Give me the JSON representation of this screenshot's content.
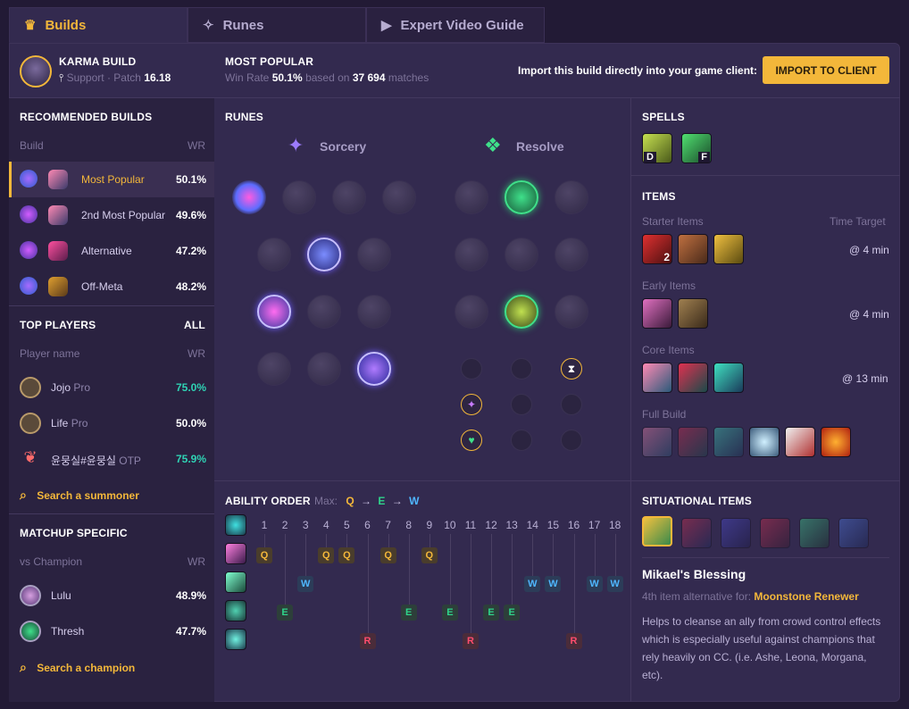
{
  "tabs": [
    {
      "label": "Builds",
      "icon": "builds-icon"
    },
    {
      "label": "Runes",
      "icon": "runes-icon"
    },
    {
      "label": "Expert Video Guide",
      "icon": "video-icon"
    }
  ],
  "header": {
    "champ_title": "KARMA BUILD",
    "role": "Support",
    "patch_prefix": "· Patch",
    "patch": "16.18",
    "mp_title": "MOST POPULAR",
    "winrate_label": "Win Rate",
    "winrate": "50.1%",
    "based_on": "based on",
    "matches": "37 694",
    "matches_suffix": "matches",
    "import_text": "Import this build directly into your game client:",
    "import_button": "IMPORT TO CLIENT"
  },
  "recommended": {
    "title": "RECOMMENDED BUILDS",
    "col_build": "Build",
    "col_wr": "WR",
    "rows": [
      {
        "name": "Most Popular",
        "wr": "50.1%",
        "active": true
      },
      {
        "name": "2nd Most Popular",
        "wr": "49.6%"
      },
      {
        "name": "Alternative",
        "wr": "47.2%"
      },
      {
        "name": "Off-Meta",
        "wr": "48.2%"
      }
    ]
  },
  "top_players": {
    "title": "TOP PLAYERS",
    "all": "ALL",
    "col_player": "Player name",
    "col_wr": "WR",
    "rows": [
      {
        "name": "Jojo",
        "tag": "Pro",
        "wr": "75.0%"
      },
      {
        "name": "Life",
        "tag": "Pro",
        "wr": "50.0%"
      },
      {
        "name": "윤뭉실#윤뭉실",
        "tag": "OTP",
        "wr": "75.9%"
      }
    ],
    "search": "Search a summoner"
  },
  "matchup": {
    "title": "MATCHUP SPECIFIC",
    "col_vs": "vs Champion",
    "col_wr": "WR",
    "rows": [
      {
        "name": "Lulu",
        "wr": "48.9%"
      },
      {
        "name": "Thresh",
        "wr": "47.7%"
      }
    ],
    "search": "Search a champion"
  },
  "runes": {
    "title": "RUNES",
    "primary": "Sorcery",
    "secondary": "Resolve"
  },
  "spells": {
    "title": "SPELLS",
    "keys": [
      "D",
      "F"
    ]
  },
  "items": {
    "title": "ITEMS",
    "starter": "Starter Items",
    "time_target": "Time Target",
    "starter_time": "@ 4 min",
    "starter_count": "2",
    "early": "Early Items",
    "early_time": "@ 4 min",
    "core": "Core Items",
    "core_time": "@ 13 min",
    "full": "Full Build"
  },
  "ability": {
    "title": "ABILITY ORDER",
    "max_label": "Max:",
    "max": [
      "Q",
      "E",
      "W"
    ],
    "arrow": "→",
    "levels": [
      "1",
      "2",
      "3",
      "4",
      "5",
      "6",
      "7",
      "8",
      "9",
      "10",
      "11",
      "12",
      "13",
      "14",
      "15",
      "16",
      "17",
      "18"
    ],
    "rows": [
      {
        "key": "Q",
        "levels": [
          1,
          4,
          5,
          7,
          9
        ]
      },
      {
        "key": "W",
        "levels": [
          3,
          14,
          15,
          17,
          18
        ]
      },
      {
        "key": "E",
        "levels": [
          2,
          8,
          10,
          12,
          13
        ]
      },
      {
        "key": "R",
        "levels": [
          6,
          11,
          16
        ]
      }
    ]
  },
  "situational": {
    "title": "SITUATIONAL ITEMS",
    "item_name": "Mikael's Blessing",
    "alt_prefix": "4th item alternative for:",
    "alt_item": "Moonstone Renewer",
    "desc": "Helps to cleanse an ally from crowd control effects which is especially useful against champions that rely heavily on CC. (i.e. Ashe, Leona, Morgana, etc)."
  },
  "colors": {
    "accent": "#f3b73a",
    "q": "#f3b73a",
    "w": "#4fb6ff",
    "e": "#2fd38a",
    "r": "#ff4d6d"
  }
}
